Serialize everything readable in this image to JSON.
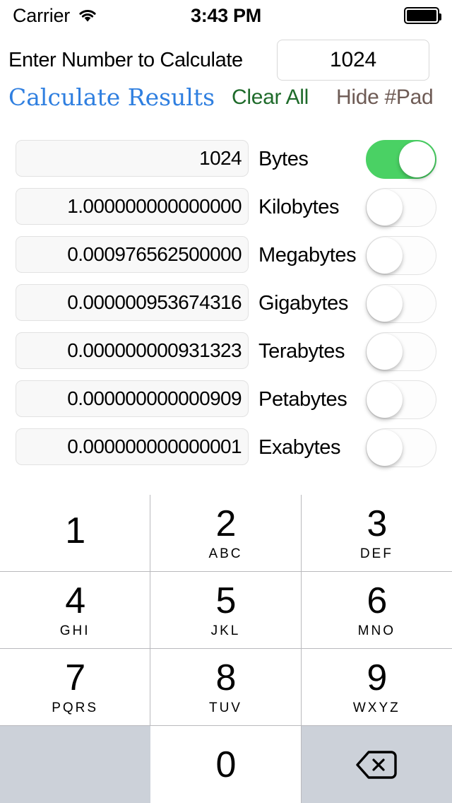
{
  "status_bar": {
    "carrier": "Carrier",
    "wifi_icon": "wifi-icon",
    "time": "3:43 PM",
    "battery_icon": "battery-full-icon"
  },
  "entry": {
    "label": "Enter Number to Calculate",
    "value": "1024",
    "placeholder": ""
  },
  "actions": {
    "calculate_label": "Calculate Results",
    "calculate_color": "#2F7FE0",
    "clear_label": "Clear All",
    "clear_color": "#1F6B2B",
    "hide_pad_label": "Hide #Pad",
    "hide_pad_color": "#6E5B55"
  },
  "toggle_colors": {
    "on": "#4AD164",
    "off_track": "#FDFDFD",
    "knob": "#FFFFFF"
  },
  "conversions": [
    {
      "value": "1024",
      "label": "Bytes",
      "toggle": "on"
    },
    {
      "value": "1.000000000000000",
      "label": "Kilobytes",
      "toggle": "off"
    },
    {
      "value": "0.000976562500000",
      "label": "Megabytes",
      "toggle": "off"
    },
    {
      "value": "0.000000953674316",
      "label": "Gigabytes",
      "toggle": "off"
    },
    {
      "value": "0.000000000931323",
      "label": "Terabytes",
      "toggle": "off"
    },
    {
      "value": "0.000000000000909",
      "label": "Petabytes",
      "toggle": "off"
    },
    {
      "value": "0.000000000000001",
      "label": "Exabytes",
      "toggle": "off"
    }
  ],
  "keypad": {
    "keys": [
      {
        "digit": "1",
        "letters": "",
        "style": "white"
      },
      {
        "digit": "2",
        "letters": "ABC",
        "style": "white"
      },
      {
        "digit": "3",
        "letters": "DEF",
        "style": "white"
      },
      {
        "digit": "4",
        "letters": "GHI",
        "style": "white"
      },
      {
        "digit": "5",
        "letters": "JKL",
        "style": "white"
      },
      {
        "digit": "6",
        "letters": "MNO",
        "style": "white"
      },
      {
        "digit": "7",
        "letters": "PQRS",
        "style": "white"
      },
      {
        "digit": "8",
        "letters": "TUV",
        "style": "white"
      },
      {
        "digit": "9",
        "letters": "WXYZ",
        "style": "white"
      },
      {
        "digit": "",
        "letters": "",
        "style": "gray"
      },
      {
        "digit": "0",
        "letters": "",
        "style": "white"
      },
      {
        "digit": "",
        "letters": "",
        "style": "gray",
        "icon": "backspace-icon"
      }
    ]
  }
}
